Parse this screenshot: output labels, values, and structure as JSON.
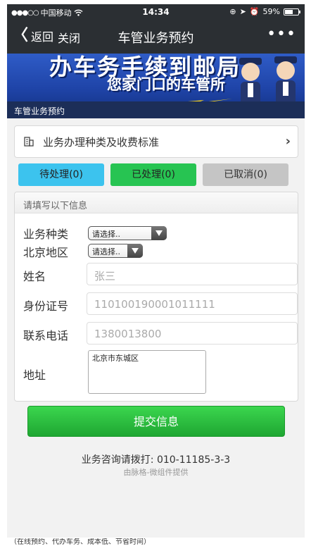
{
  "status_bar": {
    "carrier": "中国移动",
    "time": "14:34",
    "battery": "59%"
  },
  "nav": {
    "back_label": "返回",
    "close_label": "关闭",
    "title": "车管业务预约",
    "more": "•••"
  },
  "banner": {
    "line1": "办车务手续到邮局",
    "line2": "您家门口的车管所"
  },
  "section_title": "车管业务预约",
  "fee_link": "业务办理种类及收费标准",
  "tabs": [
    {
      "label": "待处理(0)",
      "color": "#3cc3ee"
    },
    {
      "label": "已处理(0)",
      "color": "#27c452"
    },
    {
      "label": "已取消(0)",
      "color": "#c5c5c5"
    }
  ],
  "form": {
    "header": "请填写以下信息",
    "business_type": {
      "label": "业务种类",
      "value": "请选择.."
    },
    "district": {
      "label": "北京地区",
      "value": "请选择.."
    },
    "name": {
      "label": "姓名",
      "placeholder": "张三"
    },
    "id_number": {
      "label": "身份证号",
      "placeholder": "110100190001011111"
    },
    "phone": {
      "label": "联系电话",
      "placeholder": "1380013800"
    },
    "address": {
      "label": "地址",
      "value": "北京市东城区"
    }
  },
  "submit_label": "提交信息",
  "hotline": "业务咨询请拨打: 010-11185-3-3",
  "credit": "由脉格-微组件提供",
  "caption": "（在线预约、代办车务、成本低、节省时间）"
}
